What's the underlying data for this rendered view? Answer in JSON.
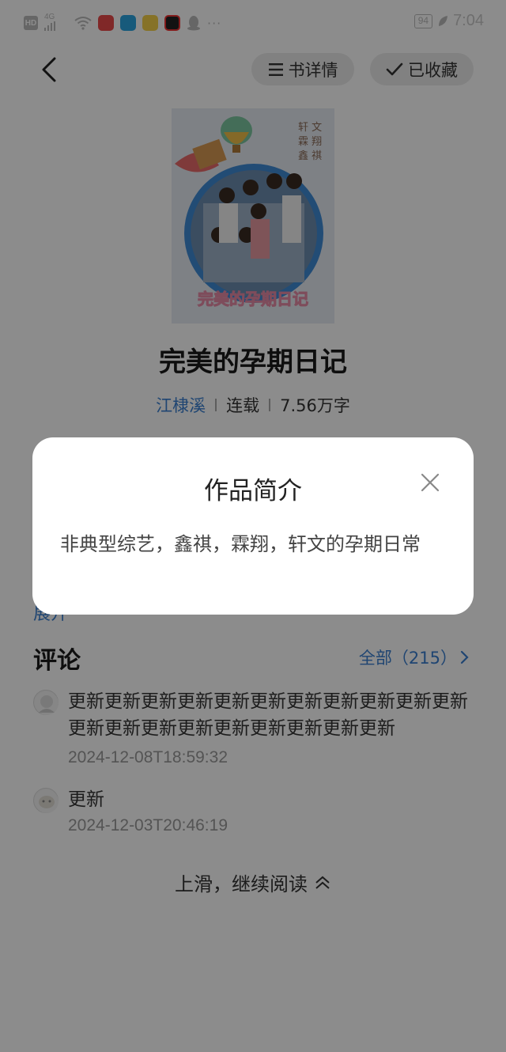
{
  "status_bar": {
    "hd": "HD",
    "signal": "4G",
    "battery": "94",
    "time": "7:04",
    "more": "···",
    "app_icons": [
      "taobao-icon",
      "app-icon",
      "weibo-icon",
      "video-icon",
      "qq-icon"
    ]
  },
  "header": {
    "back_icon": "chevron-left-icon",
    "details_label": "书详情",
    "favorited_label": "已收藏"
  },
  "book": {
    "title": "完美的孕期日记",
    "cover_title": "完美的孕期日记",
    "author": "江棣溪",
    "status": "连载",
    "word_count": "7.56万字"
  },
  "modal": {
    "title": "作品简介",
    "body": "非典型综艺，鑫祺，霖翔，轩文的孕期日常"
  },
  "expand_label": "展开",
  "comments": {
    "title": "评论",
    "all_label": "全部（215）",
    "items": [
      {
        "text": "更新更新更新更新更新更新更新更新更新更新更新更新更新更新更新更新更新更新更新更新",
        "time": "2024-12-08T18:59:32"
      },
      {
        "text": "更新",
        "time": "2024-12-03T20:46:19"
      }
    ]
  },
  "swipe_hint": "上滑，继续阅读",
  "colors": {
    "link": "#3a7fd0",
    "overlay": "rgba(0,0,0,0.45)"
  }
}
